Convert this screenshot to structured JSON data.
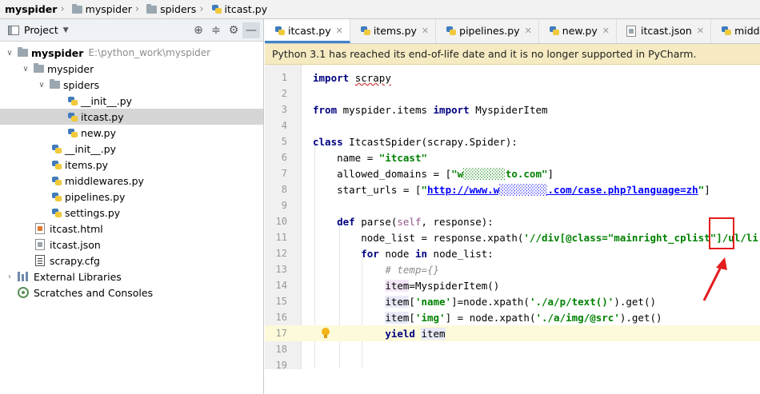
{
  "breadcrumb": {
    "project": "myspider",
    "folder1": "myspider",
    "folder2": "spiders",
    "file": "itcast.py"
  },
  "project_panel": {
    "title": "Project",
    "root": {
      "name": "myspider",
      "path": "E:\\python_work\\myspider"
    },
    "tree": [
      {
        "label": "myspider",
        "kind": "folder"
      },
      {
        "label": "spiders",
        "kind": "folder"
      },
      {
        "label": "__init__.py",
        "kind": "py"
      },
      {
        "label": "itcast.py",
        "kind": "py",
        "selected": true
      },
      {
        "label": "new.py",
        "kind": "py"
      },
      {
        "label": "__init__.py",
        "kind": "py"
      },
      {
        "label": "items.py",
        "kind": "py"
      },
      {
        "label": "middlewares.py",
        "kind": "py"
      },
      {
        "label": "pipelines.py",
        "kind": "py"
      },
      {
        "label": "settings.py",
        "kind": "py"
      },
      {
        "label": "itcast.html",
        "kind": "html"
      },
      {
        "label": "itcast.json",
        "kind": "json"
      },
      {
        "label": "scrapy.cfg",
        "kind": "cfg"
      },
      {
        "label": "External Libraries",
        "kind": "lib"
      },
      {
        "label": "Scratches and Consoles",
        "kind": "scratch"
      }
    ]
  },
  "tabs": [
    {
      "label": "itcast.py",
      "active": true
    },
    {
      "label": "items.py"
    },
    {
      "label": "pipelines.py"
    },
    {
      "label": "new.py"
    },
    {
      "label": "itcast.json"
    },
    {
      "label": "middlewares.py"
    }
  ],
  "banner": "Python 3.1 has reached its end-of-life date and it is no longer supported in PyCharm.",
  "line_numbers": [
    "1",
    "2",
    "3",
    "4",
    "5",
    "6",
    "7",
    "8",
    "9",
    "10",
    "11",
    "12",
    "13",
    "14",
    "15",
    "16",
    "17",
    "18",
    "19"
  ],
  "code": {
    "l1_kw": "import",
    "l1_mod": "scrapy",
    "l3_from": "from",
    "l3_mod": " myspider.items ",
    "l3_import": "import",
    "l3_name": " MyspiderItem",
    "l5_class": "class",
    "l5_rest": " ItcastSpider(scrapy.Spider):",
    "l6_a": "    name = ",
    "l6_str": "\"itcast\"",
    "l7_a": "    allowed_domains = [",
    "l7_str": "\"w░░░░░░░to.com\"",
    "l7_b": "]",
    "l8_a": "    start_urls = [",
    "l8_q1": "\"",
    "l8_url": "http://www.w░░░░░░░░.com/case.php?language=zh",
    "l8_q2": "\"",
    "l8_b": "]",
    "l10_def": "def",
    "l10_a": " parse(",
    "l10_self": "self",
    "l10_b": ", response):",
    "l11_a": "        node_list = response.xpath(",
    "l11_str": "'//div[@class=\"mainright_cplist\"]/ul/li'",
    "l11_b": ")",
    "l12_for": "for",
    "l12_a": " node ",
    "l12_in": "in",
    "l12_b": " node_list:",
    "l13_cmt": "# temp={}",
    "l14_item": "item",
    "l14_rest": "=MyspiderItem()",
    "l15_item": "item",
    "l15_a": "[",
    "l15_str1": "'name'",
    "l15_b": "]=node.xpath(",
    "l15_str2": "'./a/p/text()'",
    "l15_c": ").get()",
    "l16_item": "item",
    "l16_a": "[",
    "l16_str1": "'img'",
    "l16_b": "] = node.xpath(",
    "l16_str2": "'./a/img/@src'",
    "l16_c": ").get()",
    "l17_yield": "yield",
    "l17_item": "item"
  },
  "colors": {
    "keyword": "#000080",
    "string": "#008000",
    "annotation": "#e31c1c",
    "active_tab_underline": "#4083c9",
    "banner": "#f5eac1"
  }
}
